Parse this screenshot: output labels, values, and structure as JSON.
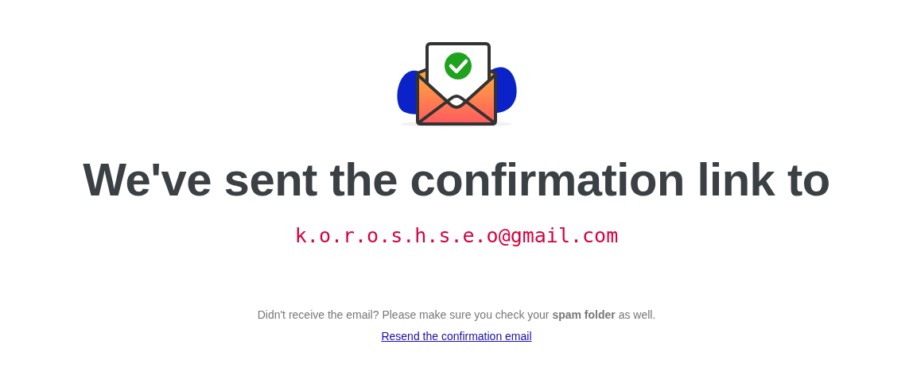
{
  "heading": "We've sent the confirmation link to",
  "email": "k.o.r.o.s.h.s.e.o@gmail.com",
  "note": "Didn't receive the email? Please make sure you check your **spam folder** as well.",
  "resend_link": "Resend the confirmation email"
}
